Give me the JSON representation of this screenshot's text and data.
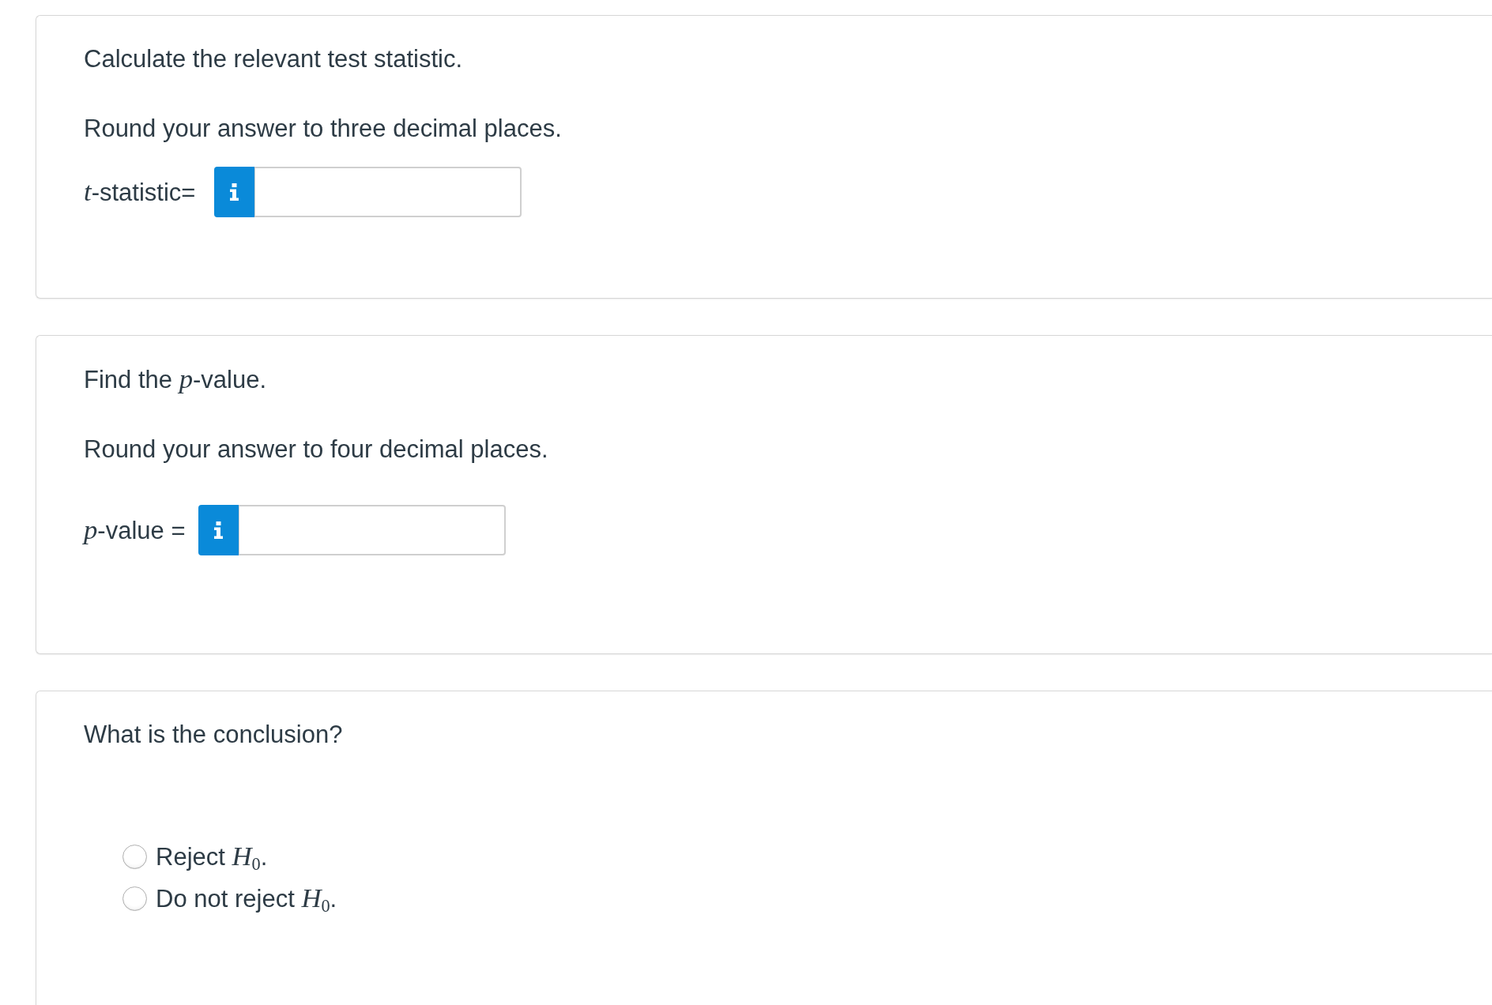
{
  "questions": [
    {
      "kind": "numeric",
      "prompt": "Calculate the relevant test statistic.",
      "instruction": "Round your answer to three decimal places.",
      "answer": {
        "label": "*t*-statistic="
      }
    },
    {
      "kind": "numeric",
      "prompt": "Find the *p*-value.",
      "instruction": "Round your answer to four decimal places.",
      "answer": {
        "label": "*p*-value ="
      }
    },
    {
      "kind": "choice",
      "prompt": "What is the conclusion?",
      "options": [
        {
          "label": "Reject *H*$_{0}$.",
          "selected": false
        },
        {
          "label": "Do not reject *H*$_{0}$.",
          "selected": false
        }
      ]
    }
  ]
}
